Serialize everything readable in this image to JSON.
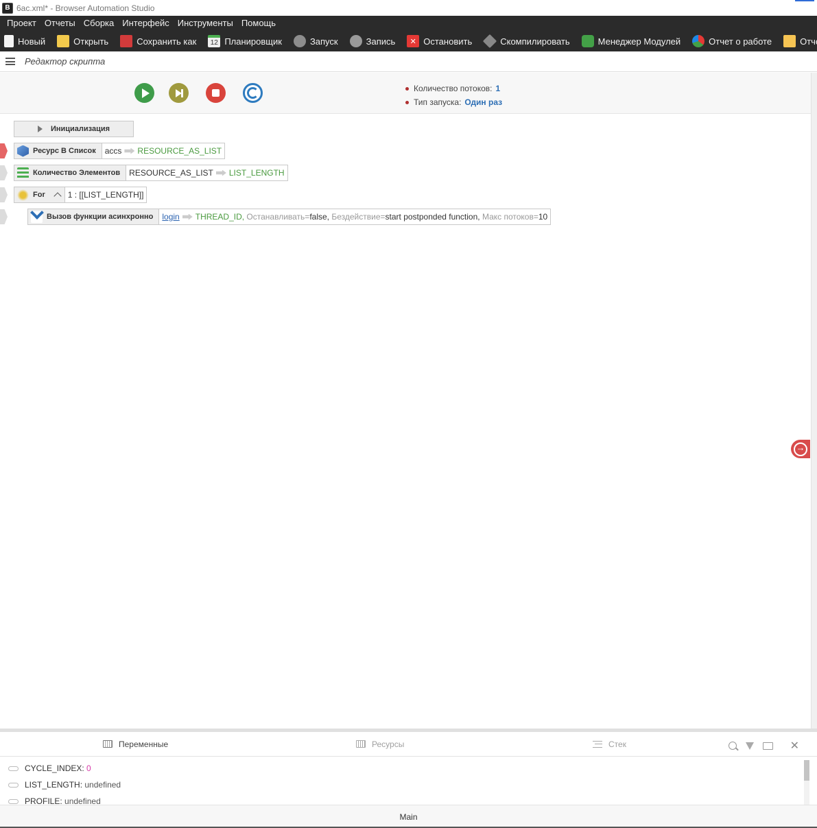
{
  "window": {
    "title": "6ac.xml* - Browser Automation Studio",
    "app_icon_letter": "B"
  },
  "menu": [
    "Проект",
    "Отчеты",
    "Сборка",
    "Интерфейс",
    "Инструменты",
    "Помощь"
  ],
  "toolbar": {
    "new": "Новый",
    "open": "Открыть",
    "save_as": "Сохранить как",
    "scheduler": "Планировщик",
    "scheduler_icon_text": "12",
    "run": "Запуск",
    "record": "Запись",
    "stop": "Остановить",
    "compile": "Скомпилировать",
    "module_manager": "Менеджер Модулей",
    "work_report": "Отчет о работе",
    "report": "Отчет о"
  },
  "editor": {
    "title": "Редактор скрипта",
    "threads_label": "Количество потоков:",
    "threads_value": "1",
    "launch_type_label": "Тип запуска:",
    "launch_type_value": "Один раз"
  },
  "script": {
    "init_label": "Инициализация",
    "actions": [
      {
        "name": "Ресурс В Список",
        "input": "accs",
        "output": "RESOURCE_AS_LIST"
      },
      {
        "name": "Количество Элементов",
        "input": "RESOURCE_AS_LIST",
        "output": "LIST_LENGTH"
      },
      {
        "name": "For",
        "params": "1 : [[LIST_LENGTH]]"
      },
      {
        "name": "Вызов функции асинхронно",
        "function": "login",
        "output": "THREAD_ID,",
        "stop_key": "Останавливать=",
        "stop_val": "false,",
        "idle_key": "Бездействие=",
        "idle_val": "start postponded function,",
        "max_key": "Макс потоков=",
        "max_val": "10"
      }
    ]
  },
  "bottom_panel": {
    "tabs": {
      "variables": "Переменные",
      "resources": "Ресурсы",
      "stack": "Стек"
    },
    "variables": [
      {
        "name": "CYCLE_INDEX:",
        "value": "0"
      },
      {
        "name": "LIST_LENGTH:",
        "value": "undefined"
      },
      {
        "name": "PROFILE:",
        "value": "undefined"
      }
    ],
    "close_symbol": "✕"
  },
  "status_bar": {
    "label": "Main"
  },
  "colors": {
    "accent_blue": "#2e6fb5",
    "var_green": "#4a9a3f",
    "run_green": "#3f9c4a",
    "stop_red": "#d9443c"
  }
}
